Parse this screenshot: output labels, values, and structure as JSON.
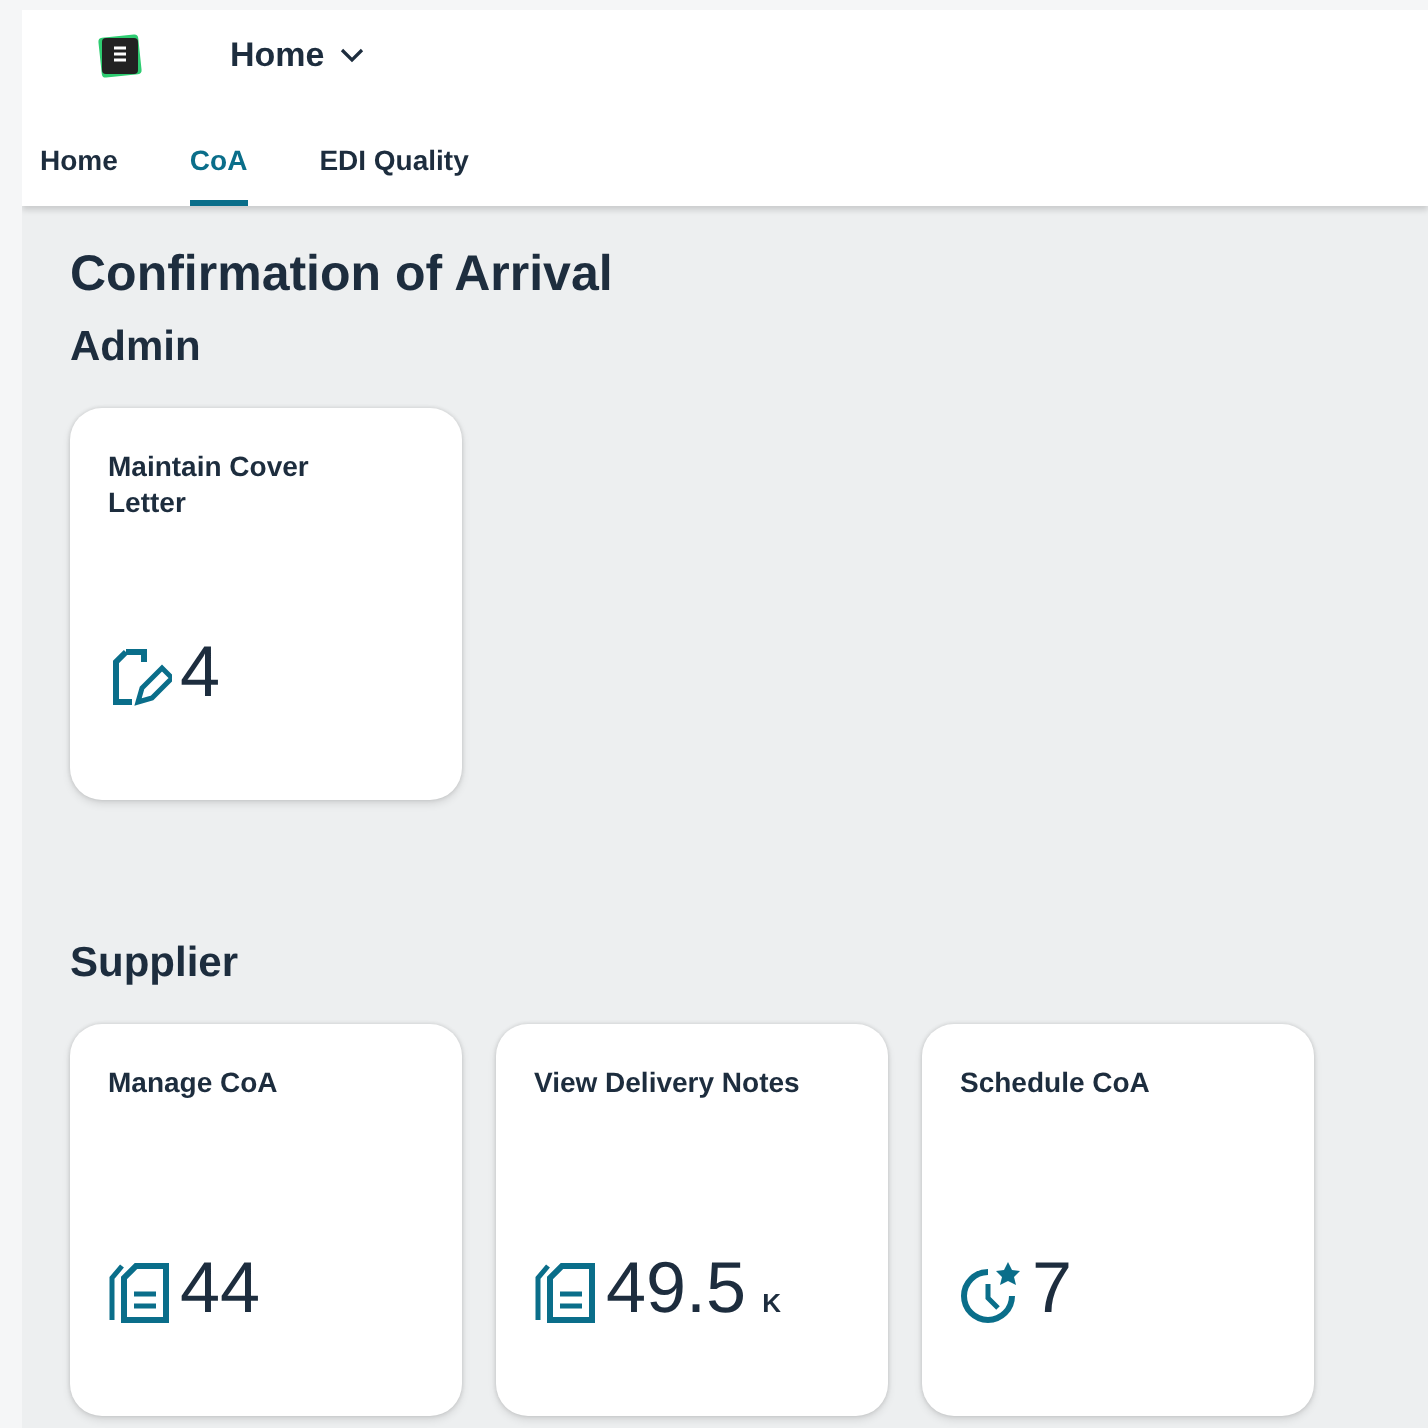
{
  "header": {
    "menu_title": "Home"
  },
  "tabs": [
    {
      "label": "Home",
      "selected": false
    },
    {
      "label": "CoA",
      "selected": true
    },
    {
      "label": "EDI Quality",
      "selected": false
    }
  ],
  "page_title": "Confirmation of Arrival",
  "sections": [
    {
      "title": "Admin",
      "tiles": [
        {
          "title": "Maintain Cover Letter",
          "kind": "edit",
          "value": "4"
        }
      ]
    },
    {
      "title": "Supplier",
      "tiles": [
        {
          "title": "Manage CoA",
          "kind": "documents",
          "value": "44"
        },
        {
          "title": "View Delivery Notes",
          "kind": "documents",
          "value": "49.5",
          "unit": "K"
        },
        {
          "title": "Schedule CoA",
          "kind": "schedule",
          "value": "7"
        }
      ]
    }
  ]
}
